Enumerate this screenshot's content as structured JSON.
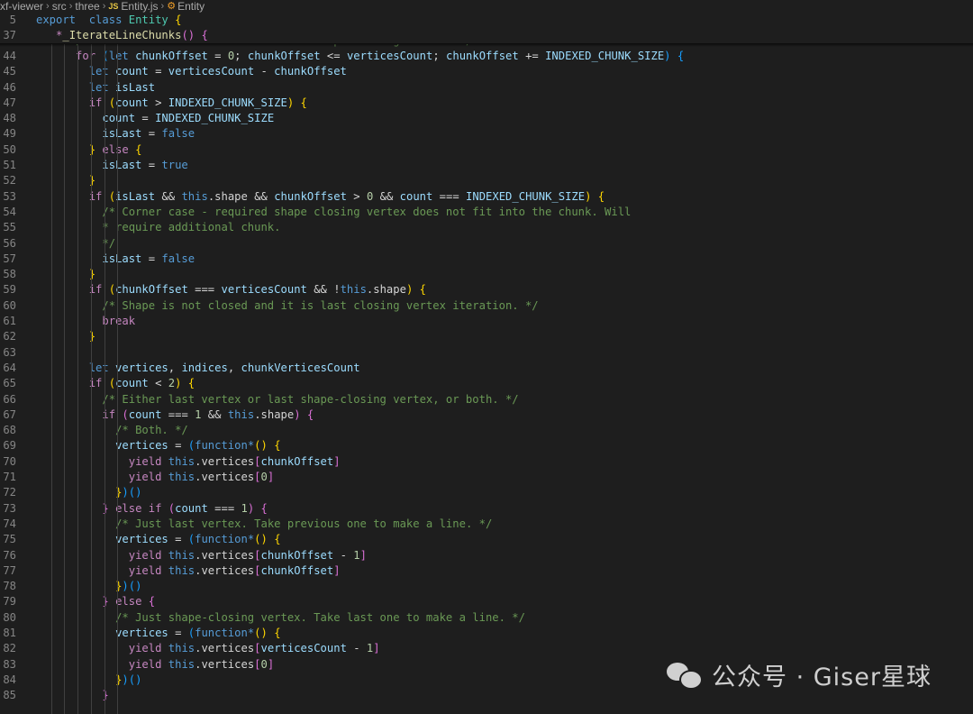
{
  "breadcrumb": {
    "items": [
      "xf-viewer",
      "src",
      "three",
      "Entity.js",
      "Entity"
    ],
    "file_icon": "JS"
  },
  "sticky_lines": [
    {
      "line": "5",
      "tokens": [
        [
          "k",
          "export"
        ],
        [
          "",
          "  "
        ],
        [
          "k",
          "class"
        ],
        [
          "",
          ""
        ],
        [
          "t",
          " Entity"
        ],
        [
          "b1",
          " {"
        ]
      ]
    },
    {
      "line": "37",
      "tokens": [
        [
          "",
          "   "
        ],
        [
          "c",
          "*"
        ],
        [
          "f",
          "_IterateLineChunks"
        ],
        [
          "b2",
          "()"
        ],
        [
          "",
          ""
        ],
        [
          "b2",
          " {"
        ]
      ]
    }
  ],
  "lines": [
    {
      "line": "43",
      "indent": 6,
      "tokens": [
        [
          "cm",
          "/* chunkOffset == verticesCount for shape closing vertex. */"
        ]
      ]
    },
    {
      "line": "44",
      "indent": 6,
      "tokens": [
        [
          "c",
          "for"
        ],
        [
          "",
          " "
        ],
        [
          "b3",
          "("
        ],
        [
          "k",
          "let"
        ],
        [
          "v",
          " chunkOffset"
        ],
        [
          "",
          " = "
        ],
        [
          "n",
          "0"
        ],
        [
          "",
          "; "
        ],
        [
          "v",
          "chunkOffset"
        ],
        [
          "",
          " <= "
        ],
        [
          "v",
          "verticesCount"
        ],
        [
          "",
          "; "
        ],
        [
          "v",
          "chunkOffset"
        ],
        [
          "",
          " += "
        ],
        [
          "v",
          "INDEXED_CHUNK_SIZE"
        ],
        [
          "b3",
          ")"
        ],
        [
          "b3",
          " {"
        ]
      ]
    },
    {
      "line": "45",
      "indent": 8,
      "tokens": [
        [
          "k",
          "let"
        ],
        [
          "v",
          " count"
        ],
        [
          "",
          " = "
        ],
        [
          "v",
          "verticesCount"
        ],
        [
          "",
          " - "
        ],
        [
          "v",
          "chunkOffset"
        ]
      ]
    },
    {
      "line": "46",
      "indent": 8,
      "tokens": [
        [
          "k",
          "let"
        ],
        [
          "v",
          " isLast"
        ]
      ]
    },
    {
      "line": "47",
      "indent": 8,
      "tokens": [
        [
          "c",
          "if"
        ],
        [
          "",
          " "
        ],
        [
          "b1",
          "("
        ],
        [
          "v",
          "count"
        ],
        [
          "",
          " > "
        ],
        [
          "v",
          "INDEXED_CHUNK_SIZE"
        ],
        [
          "b1",
          ")"
        ],
        [
          "b1",
          " {"
        ]
      ]
    },
    {
      "line": "48",
      "indent": 10,
      "tokens": [
        [
          "v",
          "count"
        ],
        [
          "",
          " = "
        ],
        [
          "v",
          "INDEXED_CHUNK_SIZE"
        ]
      ]
    },
    {
      "line": "49",
      "indent": 10,
      "tokens": [
        [
          "v",
          "isLast"
        ],
        [
          "",
          " = "
        ],
        [
          "k",
          "false"
        ]
      ]
    },
    {
      "line": "50",
      "indent": 8,
      "tokens": [
        [
          "b1",
          "}"
        ],
        [
          "",
          " "
        ],
        [
          "c",
          "else"
        ],
        [
          "b1",
          " {"
        ]
      ]
    },
    {
      "line": "51",
      "indent": 10,
      "tokens": [
        [
          "v",
          "isLast"
        ],
        [
          "",
          " = "
        ],
        [
          "k",
          "true"
        ]
      ]
    },
    {
      "line": "52",
      "indent": 8,
      "tokens": [
        [
          "b1",
          "}"
        ]
      ]
    },
    {
      "line": "53",
      "indent": 8,
      "tokens": [
        [
          "c",
          "if"
        ],
        [
          "",
          " "
        ],
        [
          "b1",
          "("
        ],
        [
          "v",
          "isLast"
        ],
        [
          "",
          " && "
        ],
        [
          "k",
          "this"
        ],
        [
          "",
          ".shape"
        ],
        [
          "",
          " && "
        ],
        [
          "v",
          "chunkOffset"
        ],
        [
          "",
          " > "
        ],
        [
          "n",
          "0"
        ],
        [
          "",
          " && "
        ],
        [
          "v",
          "count"
        ],
        [
          "",
          " === "
        ],
        [
          "v",
          "INDEXED_CHUNK_SIZE"
        ],
        [
          "b1",
          ")"
        ],
        [
          "b1",
          " {"
        ]
      ]
    },
    {
      "line": "54",
      "indent": 10,
      "tokens": [
        [
          "cm",
          "/* Corner case - required shape closing vertex does not fit into the chunk. Will"
        ]
      ]
    },
    {
      "line": "55",
      "indent": 10,
      "tokens": [
        [
          "cm",
          "* require additional chunk."
        ]
      ]
    },
    {
      "line": "56",
      "indent": 10,
      "tokens": [
        [
          "cm",
          "*/"
        ]
      ]
    },
    {
      "line": "57",
      "indent": 10,
      "tokens": [
        [
          "v",
          "isLast"
        ],
        [
          "",
          " = "
        ],
        [
          "k",
          "false"
        ]
      ]
    },
    {
      "line": "58",
      "indent": 8,
      "tokens": [
        [
          "b1",
          "}"
        ]
      ]
    },
    {
      "line": "59",
      "indent": 8,
      "tokens": [
        [
          "c",
          "if"
        ],
        [
          "",
          " "
        ],
        [
          "b1",
          "("
        ],
        [
          "v",
          "chunkOffset"
        ],
        [
          "",
          " === "
        ],
        [
          "v",
          "verticesCount"
        ],
        [
          "",
          " && !"
        ],
        [
          "k",
          "this"
        ],
        [
          "",
          ".shape"
        ],
        [
          "b1",
          ")"
        ],
        [
          "b1",
          " {"
        ]
      ]
    },
    {
      "line": "60",
      "indent": 10,
      "tokens": [
        [
          "cm",
          "/* Shape is not closed and it is last closing vertex iteration. */"
        ]
      ]
    },
    {
      "line": "61",
      "indent": 10,
      "tokens": [
        [
          "c",
          "break"
        ]
      ]
    },
    {
      "line": "62",
      "indent": 8,
      "tokens": [
        [
          "b1",
          "}"
        ]
      ]
    },
    {
      "line": "63",
      "indent": 0,
      "tokens": []
    },
    {
      "line": "64",
      "indent": 8,
      "tokens": [
        [
          "k",
          "let"
        ],
        [
          "v",
          " vertices"
        ],
        [
          "",
          ", "
        ],
        [
          "v",
          "indices"
        ],
        [
          "",
          ", "
        ],
        [
          "v",
          "chunkVerticesCount"
        ]
      ]
    },
    {
      "line": "65",
      "indent": 8,
      "tokens": [
        [
          "c",
          "if"
        ],
        [
          "",
          " "
        ],
        [
          "b1",
          "("
        ],
        [
          "v",
          "count"
        ],
        [
          "",
          " < "
        ],
        [
          "n",
          "2"
        ],
        [
          "b1",
          ")"
        ],
        [
          "b1",
          " {"
        ]
      ]
    },
    {
      "line": "66",
      "indent": 10,
      "tokens": [
        [
          "cm",
          "/* Either last vertex or last shape-closing vertex, or both. */"
        ]
      ]
    },
    {
      "line": "67",
      "indent": 10,
      "tokens": [
        [
          "c",
          "if"
        ],
        [
          "",
          " "
        ],
        [
          "b2",
          "("
        ],
        [
          "v",
          "count"
        ],
        [
          "",
          " === "
        ],
        [
          "n",
          "1"
        ],
        [
          "",
          " && "
        ],
        [
          "k",
          "this"
        ],
        [
          "",
          ".shape"
        ],
        [
          "b2",
          ")"
        ],
        [
          "b2",
          " {"
        ]
      ]
    },
    {
      "line": "68",
      "indent": 12,
      "tokens": [
        [
          "cm",
          "/* Both. */"
        ]
      ]
    },
    {
      "line": "69",
      "indent": 12,
      "tokens": [
        [
          "v",
          "vertices"
        ],
        [
          "",
          " = "
        ],
        [
          "b3",
          "("
        ],
        [
          "k",
          "function"
        ],
        [
          "",
          ""
        ],
        [
          "k",
          "*"
        ],
        [
          "b1",
          "()"
        ],
        [
          "b1",
          " {"
        ]
      ]
    },
    {
      "line": "70",
      "indent": 14,
      "tokens": [
        [
          "c",
          "yield"
        ],
        [
          "",
          " "
        ],
        [
          "k",
          "this"
        ],
        [
          "",
          ".vertices"
        ],
        [
          "b2",
          "["
        ],
        [
          "v",
          "chunkOffset"
        ],
        [
          "b2",
          "]"
        ]
      ]
    },
    {
      "line": "71",
      "indent": 14,
      "tokens": [
        [
          "c",
          "yield"
        ],
        [
          "",
          " "
        ],
        [
          "k",
          "this"
        ],
        [
          "",
          ".vertices"
        ],
        [
          "b2",
          "["
        ],
        [
          "n",
          "0"
        ],
        [
          "b2",
          "]"
        ]
      ]
    },
    {
      "line": "72",
      "indent": 12,
      "tokens": [
        [
          "b1",
          "}"
        ],
        [
          "b3",
          ")"
        ],
        [
          "b3",
          "()"
        ]
      ]
    },
    {
      "line": "73",
      "indent": 10,
      "tokens": [
        [
          "b2",
          "}"
        ],
        [
          "",
          " "
        ],
        [
          "c",
          "else if"
        ],
        [
          "",
          " "
        ],
        [
          "b2",
          "("
        ],
        [
          "v",
          "count"
        ],
        [
          "",
          " === "
        ],
        [
          "n",
          "1"
        ],
        [
          "b2",
          ")"
        ],
        [
          "b2",
          " {"
        ]
      ]
    },
    {
      "line": "74",
      "indent": 12,
      "tokens": [
        [
          "cm",
          "/* Just last vertex. Take previous one to make a line. */"
        ]
      ]
    },
    {
      "line": "75",
      "indent": 12,
      "tokens": [
        [
          "v",
          "vertices"
        ],
        [
          "",
          " = "
        ],
        [
          "b3",
          "("
        ],
        [
          "k",
          "function"
        ],
        [
          "",
          ""
        ],
        [
          "k",
          "*"
        ],
        [
          "b1",
          "()"
        ],
        [
          "b1",
          " {"
        ]
      ]
    },
    {
      "line": "76",
      "indent": 14,
      "tokens": [
        [
          "c",
          "yield"
        ],
        [
          "",
          " "
        ],
        [
          "k",
          "this"
        ],
        [
          "",
          ".vertices"
        ],
        [
          "b2",
          "["
        ],
        [
          "v",
          "chunkOffset"
        ],
        [
          "",
          " - "
        ],
        [
          "n",
          "1"
        ],
        [
          "b2",
          "]"
        ]
      ]
    },
    {
      "line": "77",
      "indent": 14,
      "tokens": [
        [
          "c",
          "yield"
        ],
        [
          "",
          " "
        ],
        [
          "k",
          "this"
        ],
        [
          "",
          ".vertices"
        ],
        [
          "b2",
          "["
        ],
        [
          "v",
          "chunkOffset"
        ],
        [
          "b2",
          "]"
        ]
      ]
    },
    {
      "line": "78",
      "indent": 12,
      "tokens": [
        [
          "b1",
          "}"
        ],
        [
          "b3",
          ")"
        ],
        [
          "b3",
          "()"
        ]
      ]
    },
    {
      "line": "79",
      "indent": 10,
      "tokens": [
        [
          "b2",
          "}"
        ],
        [
          "",
          " "
        ],
        [
          "c",
          "else"
        ],
        [
          "b2",
          " {"
        ]
      ]
    },
    {
      "line": "80",
      "indent": 12,
      "tokens": [
        [
          "cm",
          "/* Just shape-closing vertex. Take last one to make a line. */"
        ]
      ]
    },
    {
      "line": "81",
      "indent": 12,
      "tokens": [
        [
          "v",
          "vertices"
        ],
        [
          "",
          " = "
        ],
        [
          "b3",
          "("
        ],
        [
          "k",
          "function"
        ],
        [
          "",
          ""
        ],
        [
          "k",
          "*"
        ],
        [
          "b1",
          "()"
        ],
        [
          "b1",
          " {"
        ]
      ]
    },
    {
      "line": "82",
      "indent": 14,
      "tokens": [
        [
          "c",
          "yield"
        ],
        [
          "",
          " "
        ],
        [
          "k",
          "this"
        ],
        [
          "",
          ".vertices"
        ],
        [
          "b2",
          "["
        ],
        [
          "v",
          "verticesCount"
        ],
        [
          "",
          " - "
        ],
        [
          "n",
          "1"
        ],
        [
          "b2",
          "]"
        ]
      ]
    },
    {
      "line": "83",
      "indent": 14,
      "tokens": [
        [
          "c",
          "yield"
        ],
        [
          "",
          " "
        ],
        [
          "k",
          "this"
        ],
        [
          "",
          ".vertices"
        ],
        [
          "b2",
          "["
        ],
        [
          "n",
          "0"
        ],
        [
          "b2",
          "]"
        ]
      ]
    },
    {
      "line": "84",
      "indent": 12,
      "tokens": [
        [
          "b1",
          "}"
        ],
        [
          "b3",
          ")"
        ],
        [
          "b3",
          "()"
        ]
      ]
    },
    {
      "line": "85",
      "indent": 10,
      "tokens": [
        [
          "b2",
          "}"
        ]
      ]
    }
  ],
  "watermark": {
    "text": "公众号 · Giser星球",
    "icon": "wechat-icon"
  },
  "colors": {
    "background": "#1e1e1e",
    "keyword": "#569cd6",
    "control": "#c586c0",
    "class": "#4ec9b0",
    "function": "#dcdcaa",
    "variable": "#9cdcfe",
    "number": "#b5cea8",
    "comment": "#6a9955"
  }
}
